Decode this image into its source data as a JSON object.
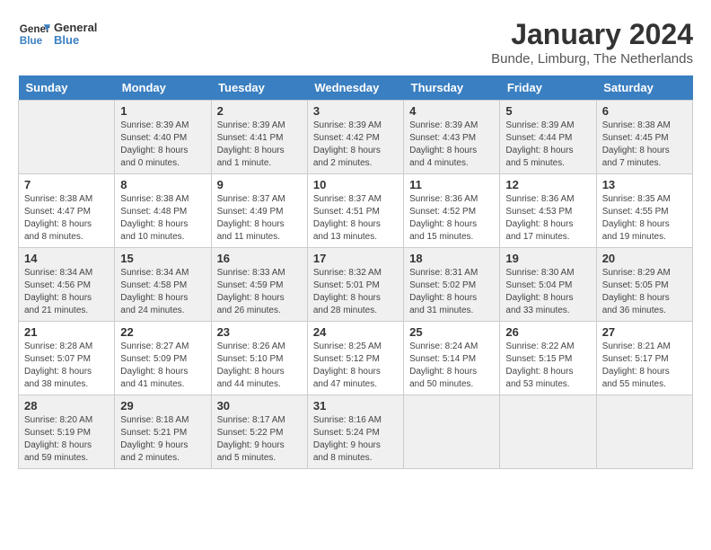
{
  "header": {
    "logo_general": "General",
    "logo_blue": "Blue",
    "month_year": "January 2024",
    "location": "Bunde, Limburg, The Netherlands"
  },
  "days_of_week": [
    "Sunday",
    "Monday",
    "Tuesday",
    "Wednesday",
    "Thursday",
    "Friday",
    "Saturday"
  ],
  "weeks": [
    [
      {
        "day": "",
        "sunrise": "",
        "sunset": "",
        "daylight": ""
      },
      {
        "day": "1",
        "sunrise": "Sunrise: 8:39 AM",
        "sunset": "Sunset: 4:40 PM",
        "daylight": "Daylight: 8 hours and 0 minutes."
      },
      {
        "day": "2",
        "sunrise": "Sunrise: 8:39 AM",
        "sunset": "Sunset: 4:41 PM",
        "daylight": "Daylight: 8 hours and 1 minute."
      },
      {
        "day": "3",
        "sunrise": "Sunrise: 8:39 AM",
        "sunset": "Sunset: 4:42 PM",
        "daylight": "Daylight: 8 hours and 2 minutes."
      },
      {
        "day": "4",
        "sunrise": "Sunrise: 8:39 AM",
        "sunset": "Sunset: 4:43 PM",
        "daylight": "Daylight: 8 hours and 4 minutes."
      },
      {
        "day": "5",
        "sunrise": "Sunrise: 8:39 AM",
        "sunset": "Sunset: 4:44 PM",
        "daylight": "Daylight: 8 hours and 5 minutes."
      },
      {
        "day": "6",
        "sunrise": "Sunrise: 8:38 AM",
        "sunset": "Sunset: 4:45 PM",
        "daylight": "Daylight: 8 hours and 7 minutes."
      }
    ],
    [
      {
        "day": "7",
        "sunrise": "Sunrise: 8:38 AM",
        "sunset": "Sunset: 4:47 PM",
        "daylight": "Daylight: 8 hours and 8 minutes."
      },
      {
        "day": "8",
        "sunrise": "Sunrise: 8:38 AM",
        "sunset": "Sunset: 4:48 PM",
        "daylight": "Daylight: 8 hours and 10 minutes."
      },
      {
        "day": "9",
        "sunrise": "Sunrise: 8:37 AM",
        "sunset": "Sunset: 4:49 PM",
        "daylight": "Daylight: 8 hours and 11 minutes."
      },
      {
        "day": "10",
        "sunrise": "Sunrise: 8:37 AM",
        "sunset": "Sunset: 4:51 PM",
        "daylight": "Daylight: 8 hours and 13 minutes."
      },
      {
        "day": "11",
        "sunrise": "Sunrise: 8:36 AM",
        "sunset": "Sunset: 4:52 PM",
        "daylight": "Daylight: 8 hours and 15 minutes."
      },
      {
        "day": "12",
        "sunrise": "Sunrise: 8:36 AM",
        "sunset": "Sunset: 4:53 PM",
        "daylight": "Daylight: 8 hours and 17 minutes."
      },
      {
        "day": "13",
        "sunrise": "Sunrise: 8:35 AM",
        "sunset": "Sunset: 4:55 PM",
        "daylight": "Daylight: 8 hours and 19 minutes."
      }
    ],
    [
      {
        "day": "14",
        "sunrise": "Sunrise: 8:34 AM",
        "sunset": "Sunset: 4:56 PM",
        "daylight": "Daylight: 8 hours and 21 minutes."
      },
      {
        "day": "15",
        "sunrise": "Sunrise: 8:34 AM",
        "sunset": "Sunset: 4:58 PM",
        "daylight": "Daylight: 8 hours and 24 minutes."
      },
      {
        "day": "16",
        "sunrise": "Sunrise: 8:33 AM",
        "sunset": "Sunset: 4:59 PM",
        "daylight": "Daylight: 8 hours and 26 minutes."
      },
      {
        "day": "17",
        "sunrise": "Sunrise: 8:32 AM",
        "sunset": "Sunset: 5:01 PM",
        "daylight": "Daylight: 8 hours and 28 minutes."
      },
      {
        "day": "18",
        "sunrise": "Sunrise: 8:31 AM",
        "sunset": "Sunset: 5:02 PM",
        "daylight": "Daylight: 8 hours and 31 minutes."
      },
      {
        "day": "19",
        "sunrise": "Sunrise: 8:30 AM",
        "sunset": "Sunset: 5:04 PM",
        "daylight": "Daylight: 8 hours and 33 minutes."
      },
      {
        "day": "20",
        "sunrise": "Sunrise: 8:29 AM",
        "sunset": "Sunset: 5:05 PM",
        "daylight": "Daylight: 8 hours and 36 minutes."
      }
    ],
    [
      {
        "day": "21",
        "sunrise": "Sunrise: 8:28 AM",
        "sunset": "Sunset: 5:07 PM",
        "daylight": "Daylight: 8 hours and 38 minutes."
      },
      {
        "day": "22",
        "sunrise": "Sunrise: 8:27 AM",
        "sunset": "Sunset: 5:09 PM",
        "daylight": "Daylight: 8 hours and 41 minutes."
      },
      {
        "day": "23",
        "sunrise": "Sunrise: 8:26 AM",
        "sunset": "Sunset: 5:10 PM",
        "daylight": "Daylight: 8 hours and 44 minutes."
      },
      {
        "day": "24",
        "sunrise": "Sunrise: 8:25 AM",
        "sunset": "Sunset: 5:12 PM",
        "daylight": "Daylight: 8 hours and 47 minutes."
      },
      {
        "day": "25",
        "sunrise": "Sunrise: 8:24 AM",
        "sunset": "Sunset: 5:14 PM",
        "daylight": "Daylight: 8 hours and 50 minutes."
      },
      {
        "day": "26",
        "sunrise": "Sunrise: 8:22 AM",
        "sunset": "Sunset: 5:15 PM",
        "daylight": "Daylight: 8 hours and 53 minutes."
      },
      {
        "day": "27",
        "sunrise": "Sunrise: 8:21 AM",
        "sunset": "Sunset: 5:17 PM",
        "daylight": "Daylight: 8 hours and 55 minutes."
      }
    ],
    [
      {
        "day": "28",
        "sunrise": "Sunrise: 8:20 AM",
        "sunset": "Sunset: 5:19 PM",
        "daylight": "Daylight: 8 hours and 59 minutes."
      },
      {
        "day": "29",
        "sunrise": "Sunrise: 8:18 AM",
        "sunset": "Sunset: 5:21 PM",
        "daylight": "Daylight: 9 hours and 2 minutes."
      },
      {
        "day": "30",
        "sunrise": "Sunrise: 8:17 AM",
        "sunset": "Sunset: 5:22 PM",
        "daylight": "Daylight: 9 hours and 5 minutes."
      },
      {
        "day": "31",
        "sunrise": "Sunrise: 8:16 AM",
        "sunset": "Sunset: 5:24 PM",
        "daylight": "Daylight: 9 hours and 8 minutes."
      },
      {
        "day": "",
        "sunrise": "",
        "sunset": "",
        "daylight": ""
      },
      {
        "day": "",
        "sunrise": "",
        "sunset": "",
        "daylight": ""
      },
      {
        "day": "",
        "sunrise": "",
        "sunset": "",
        "daylight": ""
      }
    ]
  ]
}
